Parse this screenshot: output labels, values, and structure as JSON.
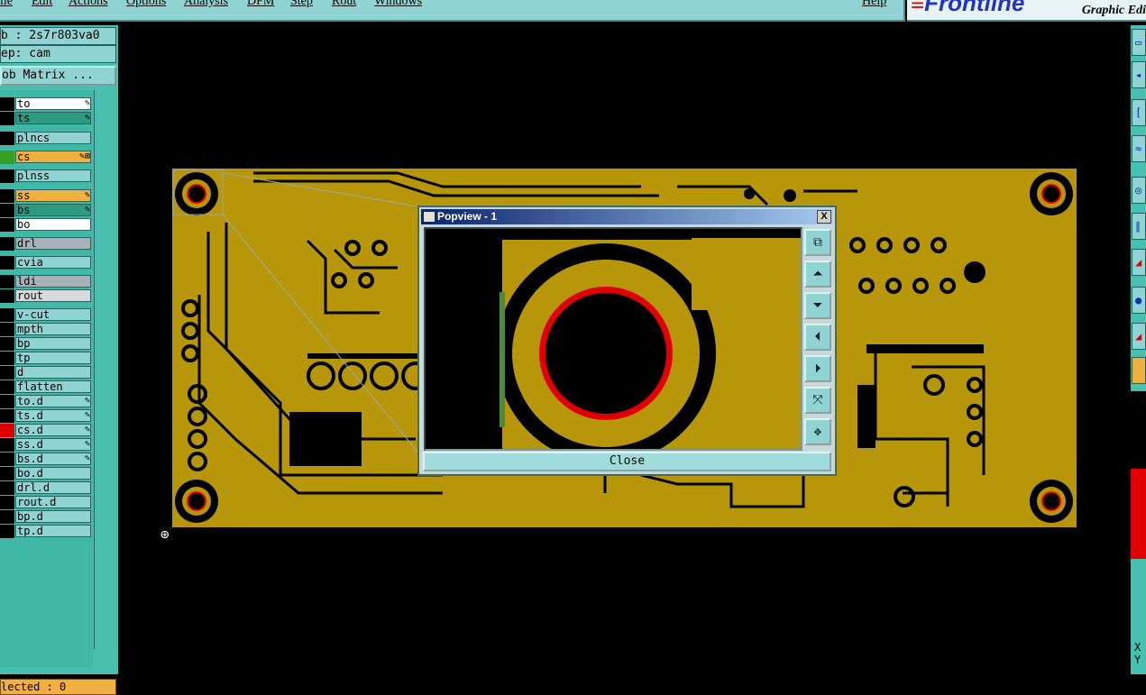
{
  "menubar": {
    "items": [
      "ile",
      "Edit",
      "Actions",
      "Options",
      "Analysis",
      "DFM",
      "Step",
      "Rout",
      "Windows",
      "Help"
    ]
  },
  "brand": {
    "logo": "Frontline",
    "tagline": "Graphic Edi"
  },
  "left_panel": {
    "job": "b : 2s7r803va0",
    "step": "ep: cam",
    "job_matrix_button": "ob Matrix ...",
    "layers": [
      {
        "name": "to",
        "bg": "#ffffff",
        "swatch": "#000000",
        "icon": "edit"
      },
      {
        "name": "ts",
        "bg": "#2e9a80",
        "swatch": "#000000",
        "icon": "edit"
      },
      {
        "name": "plncs",
        "bg": "#8fd3d3",
        "swatch": "#000000",
        "icon": ""
      },
      {
        "name": "cs",
        "bg": "#f0b040",
        "swatch": "#38a020",
        "icon": "edit+"
      },
      {
        "name": "plnss",
        "bg": "#8fd3d3",
        "swatch": "#000000",
        "icon": ""
      },
      {
        "name": "ss",
        "bg": "#f0b040",
        "swatch": "#000000",
        "icon": "edit"
      },
      {
        "name": "bs",
        "bg": "#2e9a80",
        "swatch": "#000000",
        "icon": "edit"
      },
      {
        "name": "bo",
        "bg": "#ffffff",
        "swatch": "#000000",
        "icon": ""
      },
      {
        "name": "drl",
        "bg": "#a8b0b8",
        "swatch": "#000000",
        "icon": ""
      },
      {
        "name": "cvia",
        "bg": "#8fd3d3",
        "swatch": "#000000",
        "icon": ""
      },
      {
        "name": "ldi",
        "bg": "#a8b0b8",
        "swatch": "#000000",
        "icon": ""
      },
      {
        "name": "rout",
        "bg": "#d8d8d8",
        "swatch": "#000000",
        "icon": ""
      },
      {
        "name": "v-cut",
        "bg": "#8fd3d3",
        "swatch": "#000000",
        "icon": ""
      },
      {
        "name": "mpth",
        "bg": "#8fd3d3",
        "swatch": "#000000",
        "icon": ""
      },
      {
        "name": "bp",
        "bg": "#8fd3d3",
        "swatch": "#000000",
        "icon": ""
      },
      {
        "name": "tp",
        "bg": "#8fd3d3",
        "swatch": "#000000",
        "icon": ""
      },
      {
        "name": "d",
        "bg": "#8fd3d3",
        "swatch": "#000000",
        "icon": ""
      },
      {
        "name": "flatten",
        "bg": "#8fd3d3",
        "swatch": "#000000",
        "icon": ""
      },
      {
        "name": "to.d",
        "bg": "#8fd3d3",
        "swatch": "#000000",
        "icon": "edit"
      },
      {
        "name": "ts.d",
        "bg": "#8fd3d3",
        "swatch": "#000000",
        "icon": "edit"
      },
      {
        "name": "cs.d",
        "bg": "#8fd3d3",
        "swatch": "#e00000",
        "icon": "edit"
      },
      {
        "name": "ss.d",
        "bg": "#8fd3d3",
        "swatch": "#000000",
        "icon": "edit"
      },
      {
        "name": "bs.d",
        "bg": "#8fd3d3",
        "swatch": "#000000",
        "icon": "edit"
      },
      {
        "name": "bo.d",
        "bg": "#8fd3d3",
        "swatch": "#000000",
        "icon": ""
      },
      {
        "name": "drl.d",
        "bg": "#8fd3d3",
        "swatch": "#000000",
        "icon": ""
      },
      {
        "name": "rout.d",
        "bg": "#8fd3d3",
        "swatch": "#000000",
        "icon": ""
      },
      {
        "name": "bp.d",
        "bg": "#8fd3d3",
        "swatch": "#000000",
        "icon": ""
      },
      {
        "name": "tp.d",
        "bg": "#8fd3d3",
        "swatch": "#000000",
        "icon": ""
      }
    ],
    "selected_status": "lected : 0"
  },
  "right_toolbar": {
    "labels": [
      "X",
      "Y"
    ]
  },
  "popview": {
    "title": "Popview - 1",
    "close_x": "X",
    "close_button": "Close",
    "tools": [
      "zoom-window-icon",
      "pan-up-icon",
      "pan-down-icon",
      "pan-left-icon",
      "pan-right-icon",
      "zoom-fit-icon",
      "zoom-home-icon"
    ]
  },
  "colors": {
    "board": "#b8960a",
    "panel": "#48c0b0",
    "button": "#8fd3d3",
    "highlight": "#e00000"
  }
}
